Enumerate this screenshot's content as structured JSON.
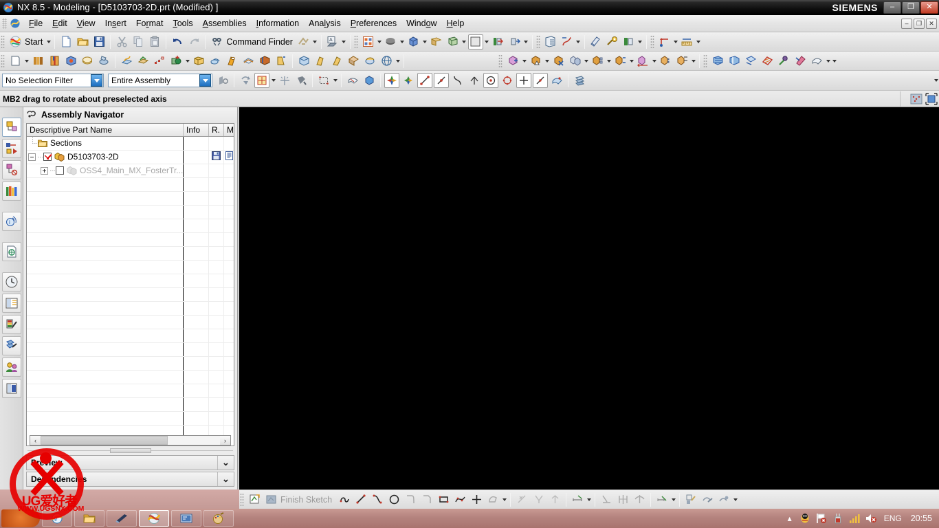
{
  "window": {
    "title": "NX 8.5 - Modeling - [D5103703-2D.prt (Modified) ]",
    "brand": "SIEMENS",
    "app_icon": "nx-logo-icon",
    "buttons": {
      "minimize": "–",
      "restore": "❐",
      "close": "✕"
    }
  },
  "menubar": {
    "items": [
      {
        "label": "File",
        "accel": "F"
      },
      {
        "label": "Edit",
        "accel": "E"
      },
      {
        "label": "View",
        "accel": "V"
      },
      {
        "label": "Insert",
        "accel": "s"
      },
      {
        "label": "Format",
        "accel": "r"
      },
      {
        "label": "Tools",
        "accel": "T"
      },
      {
        "label": "Assemblies",
        "accel": "A"
      },
      {
        "label": "Information",
        "accel": "I"
      },
      {
        "label": "Analysis",
        "accel": "l"
      },
      {
        "label": "Preferences",
        "accel": "P"
      },
      {
        "label": "Window",
        "accel": "o"
      },
      {
        "label": "Help",
        "accel": "H"
      }
    ],
    "doc_buttons": {
      "minimize": "–",
      "restore": "❐",
      "close": "✕"
    }
  },
  "toolbar_standard": {
    "start_label": "Start",
    "command_finder_label": "Command Finder",
    "items": [
      "start-menu-button",
      "new-file-icon",
      "open-file-icon",
      "save-icon",
      "cut-icon",
      "copy-icon",
      "paste-icon",
      "undo-icon",
      "redo-icon",
      "command-finder-icon",
      "repeat-command-icon",
      "print-icon",
      "plot-icon"
    ]
  },
  "toolbar_feature": {
    "items": [
      "sketch-icon",
      "datum-plane-icon",
      "extrude-icon",
      "revolve-icon",
      "hole-icon",
      "boss-icon",
      "pocket-icon",
      "pad-icon",
      "slot-icon",
      "groove-icon",
      "blend-icon",
      "chamfer-icon",
      "shell-icon",
      "thread-icon",
      "trim-body-icon",
      "unite-icon",
      "subtract-icon",
      "intersect-icon",
      "pattern-feature-icon",
      "mirror-feature-icon",
      "offset-face-icon",
      "draft-icon",
      "sew-icon",
      "thicken-icon",
      "move-object-icon"
    ]
  },
  "toolbar_view": {
    "items": [
      "fit-view-icon",
      "zoom-icon",
      "rotate-icon",
      "pan-icon",
      "style-shaded-icon",
      "true-shading-icon",
      "perspective-icon",
      "clip-section-icon",
      "background-icon",
      "layer-settings-icon",
      "wcs-icon",
      "measure-distance-icon",
      "measure-angle-icon"
    ]
  },
  "toolbar_assembly": {
    "items": [
      "add-component-icon",
      "new-component-icon",
      "mirror-assembly-icon",
      "pattern-component-icon",
      "replace-component-icon",
      "move-component-icon",
      "assembly-constraints-icon",
      "show-degrees-of-freedom-icon",
      "arrangements-icon",
      "exploded-view-icon",
      "tracelines-icon",
      "sequence-icon",
      "clearance-analysis-icon",
      "weld-assistant-icon",
      "deform-part-icon"
    ]
  },
  "selection_bar": {
    "filter": {
      "value": "No Selection Filter",
      "name": "selection-filter-combo"
    },
    "scope": {
      "value": "Entire Assembly",
      "name": "selection-scope-combo"
    },
    "icons": [
      "keep-selected-icon",
      "snap-point-filter-icon",
      "highlight-icon",
      "select-general-objects-icon",
      "face-select-icon",
      "body-select-icon",
      "rectangle-select-icon",
      "feature-select-icon",
      "component-select-icon",
      "snap-point-enabled-icon",
      "snap-end-point-icon",
      "snap-midpoint-icon",
      "snap-control-point-icon",
      "snap-intersection-icon",
      "snap-arc-center-icon",
      "snap-quadrant-icon",
      "snap-existing-point-icon",
      "snap-point-on-curve-icon",
      "snap-point-on-face-icon",
      "select-objects-by-layer-icon"
    ]
  },
  "cue_line": {
    "text": "MB2 drag to rotate about preselected axis",
    "right_icons": [
      "part-navigator-status-icon",
      "full-screen-icon"
    ]
  },
  "resource_bar": {
    "items": [
      {
        "name": "assembly-navigator-icon",
        "active": true
      },
      {
        "name": "constraint-navigator-icon",
        "active": false
      },
      {
        "name": "part-navigator-icon",
        "active": false
      },
      {
        "name": "reuse-library-icon",
        "active": false
      },
      {
        "name": "hd3d-tools-icon",
        "active": false
      },
      {
        "name": "web-browser-icon",
        "active": false
      },
      {
        "name": "history-icon",
        "active": false
      },
      {
        "name": "system-materials-icon",
        "active": false
      },
      {
        "name": "system-scene-icon",
        "active": false
      },
      {
        "name": "system-visualization-icon",
        "active": false
      },
      {
        "name": "roles-icon",
        "active": false
      },
      {
        "name": "process-studio-icon",
        "active": false
      }
    ]
  },
  "assembly_navigator": {
    "title": "Assembly Navigator",
    "icon": "assembly-navigator-icon",
    "columns": [
      "Descriptive Part Name",
      "Info",
      "R.",
      "M"
    ],
    "rows": [
      {
        "label": "Sections",
        "indent": 1,
        "icon": "folder-icon",
        "has_checkbox": false,
        "checked": false,
        "expander": "none",
        "greyed": false,
        "info": "",
        "read_only_icon": "",
        "modified_icon": ""
      },
      {
        "label": "D5103703-2D",
        "indent": 0,
        "icon": "assembly-part-icon",
        "has_checkbox": true,
        "checked": true,
        "expander": "minus",
        "greyed": false,
        "info": "",
        "read_only_icon": "save-floppy-icon",
        "modified_icon": "modified-document-icon"
      },
      {
        "label": "OSS4_Main_MX_FosterTr...",
        "indent": 1,
        "icon": "component-part-icon",
        "has_checkbox": true,
        "checked": false,
        "expander": "plus",
        "greyed": true,
        "info": "",
        "read_only_icon": "",
        "modified_icon": ""
      }
    ],
    "empty_row_count": 22,
    "hscroll": {
      "left_arrow": "‹",
      "right_arrow": "›"
    },
    "panels": [
      {
        "label": "Preview",
        "chevron": "⌄",
        "expanded": false
      },
      {
        "label": "Dependencies",
        "chevron": "⌄",
        "expanded": false
      }
    ]
  },
  "watermark": {
    "line1": "UG爱好者",
    "line2": "WWW.UGSNX.COM",
    "color": "#e60000"
  },
  "sketch_toolbar": {
    "finish_label": "Finish Sketch",
    "items": [
      "sketch-in-task-env-icon",
      "finish-sketch-icon",
      "profile-icon",
      "line-icon",
      "arc-icon",
      "circle-icon",
      "fillet-icon",
      "chamfer-icon",
      "rectangle-icon",
      "studio-spline-icon",
      "point-icon",
      "offset-curve-icon",
      "quick-trim-icon",
      "quick-extend-icon",
      "make-corner-icon",
      "constraints-icon",
      "inferred-dimensions-icon",
      "perpendicular-constraint-icon",
      "make-symmetric-icon",
      "animate-dimension-icon",
      "edit-defining-section-icon",
      "sketch-style-icon",
      "update-model-icon"
    ]
  },
  "taskbar": {
    "start_button": "start-orb",
    "tasks": [
      {
        "name": "internet-explorer-task",
        "active": false
      },
      {
        "name": "folder-task",
        "active": false
      },
      {
        "name": "photoshop-task",
        "active": false
      },
      {
        "name": "nx-task",
        "active": true
      },
      {
        "name": "remote-desktop-task",
        "active": false
      },
      {
        "name": "paint-task",
        "active": false
      }
    ],
    "tray": {
      "overflow_arrow": "▴",
      "icons": [
        "qq-penguin-icon",
        "flag-alert-icon",
        "usb-device-icon",
        "network-signal-icon",
        "volume-muted-icon"
      ],
      "language": "ENG",
      "clock": "20:55"
    }
  },
  "colors": {
    "graphics_background": "#000000",
    "title_bar": "#101010",
    "taskbar": "#b4837e",
    "accent_blue": "#1d6fc0",
    "watermark_red": "#e60000"
  }
}
